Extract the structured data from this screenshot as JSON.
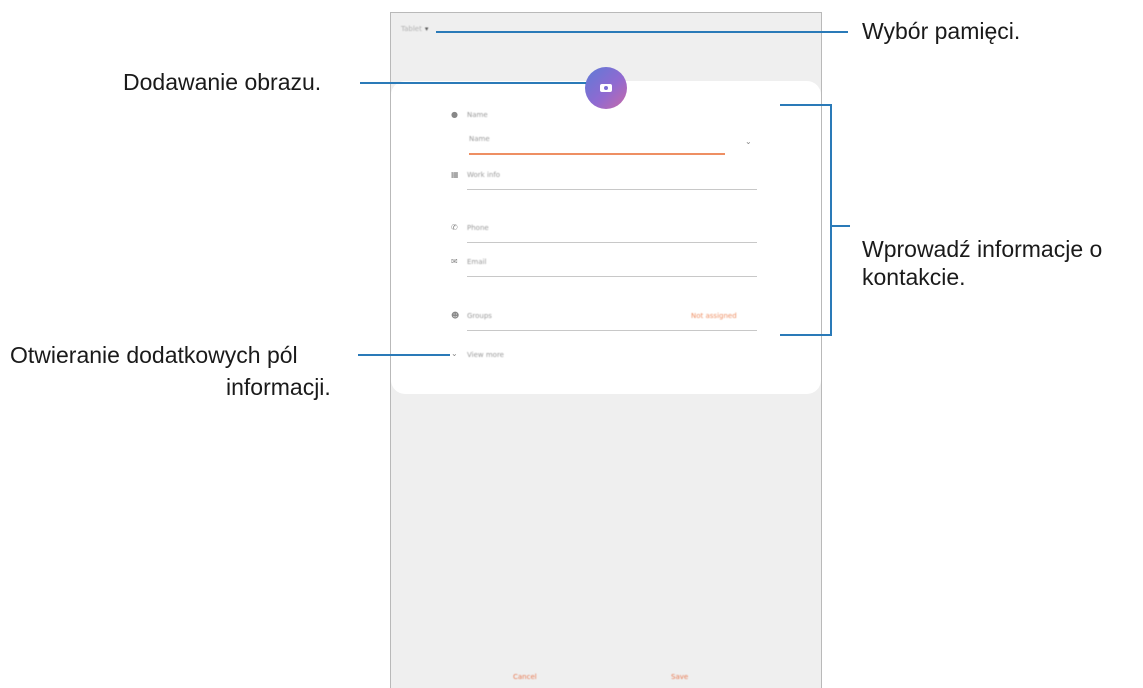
{
  "screen": {
    "storage_selector": "Tablet",
    "photo_button_icon": "camera-icon",
    "fields": {
      "name_section": "Name",
      "name_input": "Name",
      "work_info": "Work info",
      "phone": "Phone",
      "email": "Email",
      "groups": "Groups",
      "groups_value": "Not assigned",
      "view_more": "View more"
    },
    "buttons": {
      "cancel": "Cancel",
      "save": "Save"
    }
  },
  "annotations": {
    "storage": "Wybór pamięci.",
    "image": "Dodawanie obrazu.",
    "contact_info_line1": "Wprowadź informacje o",
    "contact_info_line2": "kontakcie.",
    "more_fields_line1": "Otwieranie dodatkowych pól",
    "more_fields_line2": "informacji."
  },
  "colors": {
    "accent_orange": "#ee8f63",
    "leader_line_blue": "#2a7ab8",
    "avatar_gradient_start": "#5d7bd6",
    "avatar_gradient_end": "#c86aa8"
  }
}
